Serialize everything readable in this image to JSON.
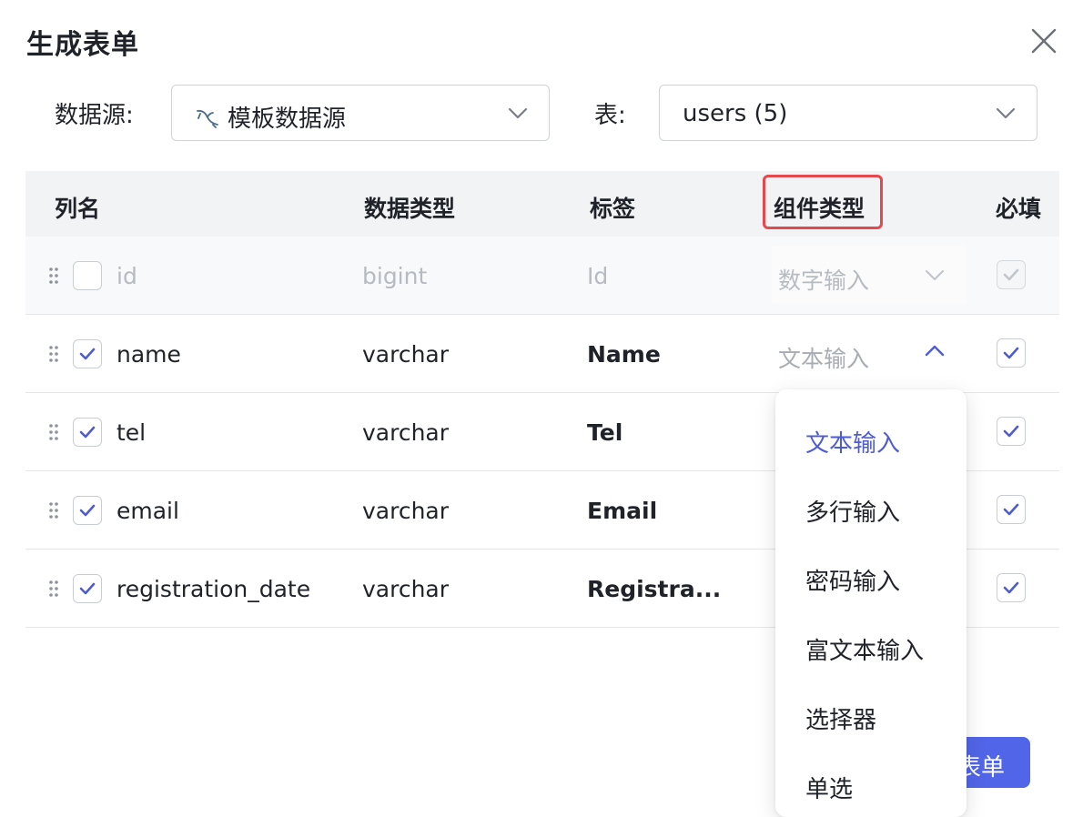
{
  "dialog": {
    "title": "生成表单"
  },
  "datasource": {
    "label": "数据源:",
    "value": "模板数据源",
    "icon": "mysql-dolphin-icon"
  },
  "table_select": {
    "label": "表:",
    "value": "users (5)"
  },
  "columns_header": {
    "name": "列名",
    "data_type": "数据类型",
    "label": "标签",
    "component_type": "组件类型",
    "required": "必填"
  },
  "rows": [
    {
      "name": "id",
      "data_type": "bigint",
      "label": "Id",
      "component": "数字输入",
      "checked": false,
      "required": true,
      "disabled": true
    },
    {
      "name": "name",
      "data_type": "varchar",
      "label": "Name",
      "component": "文本输入",
      "checked": true,
      "required": true,
      "disabled": false
    },
    {
      "name": "tel",
      "data_type": "varchar",
      "label": "Tel",
      "component": "",
      "checked": true,
      "required": true,
      "disabled": false
    },
    {
      "name": "email",
      "data_type": "varchar",
      "label": "Email",
      "component": "",
      "checked": true,
      "required": true,
      "disabled": false
    },
    {
      "name": "registration_date",
      "data_type": "varchar",
      "label": "Registra...",
      "component": "",
      "checked": true,
      "required": true,
      "disabled": false
    }
  ],
  "component_dropdown": {
    "options": [
      "文本输入",
      "多行输入",
      "密码输入",
      "富文本输入",
      "选择器",
      "单选"
    ],
    "selected": "文本输入"
  },
  "footer": {
    "submit_label_visible": "表单"
  },
  "colors": {
    "accent": "#5165e8",
    "checkbox_check": "#4e5cd4",
    "highlight": "#e5484d",
    "header_bg": "#f2f3f5"
  }
}
